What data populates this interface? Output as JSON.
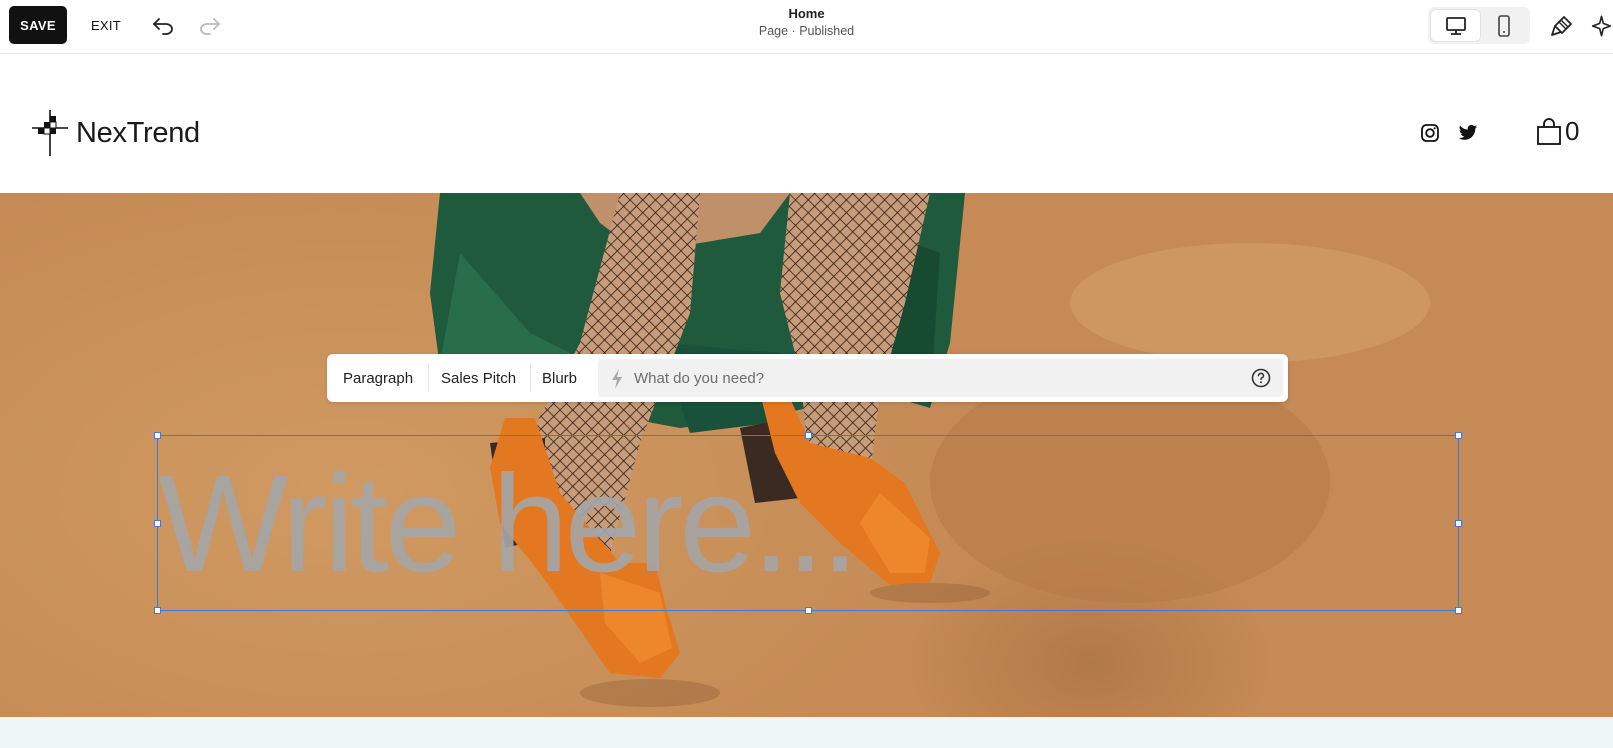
{
  "toolbar": {
    "save_label": "SAVE",
    "exit_label": "EXIT",
    "undo_icon": "undo-icon",
    "redo_icon": "redo-icon",
    "page_title": "Home",
    "page_status": "Page · Published",
    "device_options": [
      "desktop",
      "mobile"
    ],
    "active_device": "desktop",
    "design_icon": "paintbrush-icon",
    "ai_icon": "sparkle-icon"
  },
  "site": {
    "logo_text": "NexTrend",
    "social": [
      "instagram",
      "twitter"
    ],
    "cart_count": "0"
  },
  "ai_toolbar": {
    "chips": [
      "Paragraph",
      "Sales Pitch",
      "Blurb"
    ],
    "input_placeholder": "What do you need?",
    "input_value": "",
    "help_icon": "help-circle-icon"
  },
  "text_block": {
    "placeholder": "Write here..."
  },
  "colors": {
    "accent": "#3e7bd8",
    "save_bg": "#111111",
    "hero_bg": "#c48a55",
    "footer_strip": "#eef7f5"
  }
}
